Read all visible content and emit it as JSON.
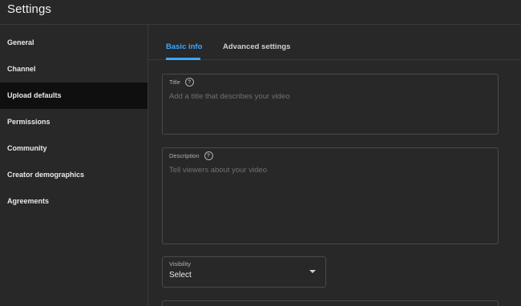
{
  "header": {
    "title": "Settings"
  },
  "sidebar": {
    "items": [
      {
        "label": "General"
      },
      {
        "label": "Channel"
      },
      {
        "label": "Upload defaults",
        "active": true
      },
      {
        "label": "Permissions"
      },
      {
        "label": "Community"
      },
      {
        "label": "Creator demographics"
      },
      {
        "label": "Agreements"
      }
    ]
  },
  "tabs": [
    {
      "label": "Basic info",
      "active": true
    },
    {
      "label": "Advanced settings"
    }
  ],
  "form": {
    "title": {
      "label": "Title",
      "help_icon": "?",
      "placeholder": "Add a title that describes your video"
    },
    "description": {
      "label": "Description",
      "help_icon": "?",
      "placeholder": "Tell viewers about your video"
    },
    "visibility": {
      "label": "Visibility",
      "value": "Select"
    }
  },
  "colors": {
    "background": "#282828",
    "active_item_bg": "#0f0f0f",
    "accent": "#3ea6ff"
  }
}
